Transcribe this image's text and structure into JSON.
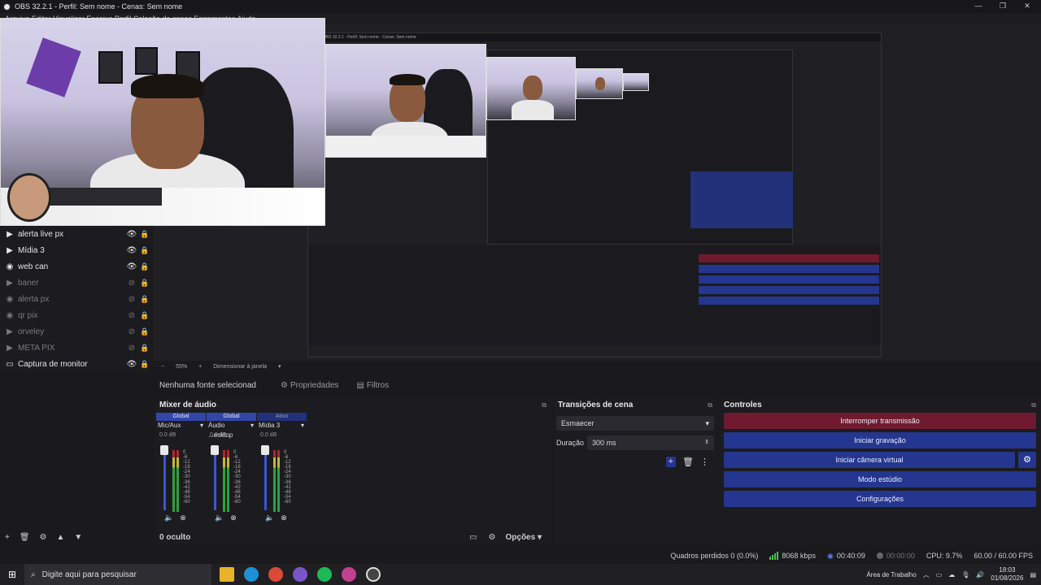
{
  "window": {
    "title": "OBS 32.2.1 - Perfil: Sem nome - Cenas: Sem nome",
    "menu": "Arquivo  Editar  Visualizar  Encaixe  Perfil  Coleção de cenas  Ferramentas  Ajuda"
  },
  "nested_title": "OBS 32.2.1 - Perfil: Sem nome - Cenas: Sem nome",
  "sources": [
    {
      "name": "alerta live px",
      "type": "play",
      "visible": true
    },
    {
      "name": "Mídia 3",
      "type": "play",
      "visible": true
    },
    {
      "name": "web can",
      "type": "camera",
      "visible": true
    },
    {
      "name": "baner",
      "type": "play",
      "visible": false
    },
    {
      "name": "alerta px",
      "type": "camera",
      "visible": false
    },
    {
      "name": "qr pix",
      "type": "camera",
      "visible": false
    },
    {
      "name": "orveley",
      "type": "play",
      "visible": false
    },
    {
      "name": "META PIX",
      "type": "play",
      "visible": false
    },
    {
      "name": "Captura de monitor",
      "type": "monitor",
      "visible": true
    }
  ],
  "preview_bar": {
    "minus": "−",
    "zoom": "55%",
    "plus": "+",
    "scale_mode": "Dimensionar à janela"
  },
  "source_bar": {
    "no_source": "Nenhuma fonte selecionad",
    "properties": "Propriedades",
    "filters": "Filtros"
  },
  "mixer": {
    "title": "Mixer de áudio",
    "header": [
      "Global",
      "Global",
      "Ativo"
    ],
    "channels": [
      {
        "name": "Mic/Aux",
        "db": "0.0 dB"
      },
      {
        "name": "Áudio ...esktop",
        "db": "0.0 dB"
      },
      {
        "name": "Mídia 3",
        "db": "0.0 dB"
      }
    ],
    "scale": [
      "0",
      "-6",
      "-12",
      "-18",
      "-24",
      "-30",
      "-36",
      "-42",
      "-48",
      "-54",
      "-60"
    ],
    "footer": {
      "hidden_count": "0 oculto",
      "options": "Opções"
    }
  },
  "transitions": {
    "title": "Transições de cena",
    "selected": "Esmaecer",
    "duration_label": "Duração",
    "duration_value": "300 ms"
  },
  "controls": {
    "title": "Controles",
    "stop_stream": "Interromper transmissão",
    "start_recording": "Iniciar gravação",
    "start_vcam": "Iniciar câmera virtual",
    "studio_mode": "Modo estúdio",
    "settings": "Configurações"
  },
  "status": {
    "dropped": "Quadros perdidos 0 (0.0%)",
    "bitrate": "8068 kbps",
    "live_time": "00:40:09",
    "rec_time": "00:00:00",
    "cpu": "CPU: 9.7%",
    "fps": "60.00 / 60.00 FPS"
  },
  "taskbar": {
    "search_placeholder": "Digite aqui para pesquisar",
    "desktop_label": "Área de Trabalho",
    "time": "18:03",
    "date": "01/08/2026"
  },
  "colors": {
    "accent_blue": "#24368f",
    "stop_red": "#6f1a2e",
    "meter_green": "#29a43b"
  }
}
